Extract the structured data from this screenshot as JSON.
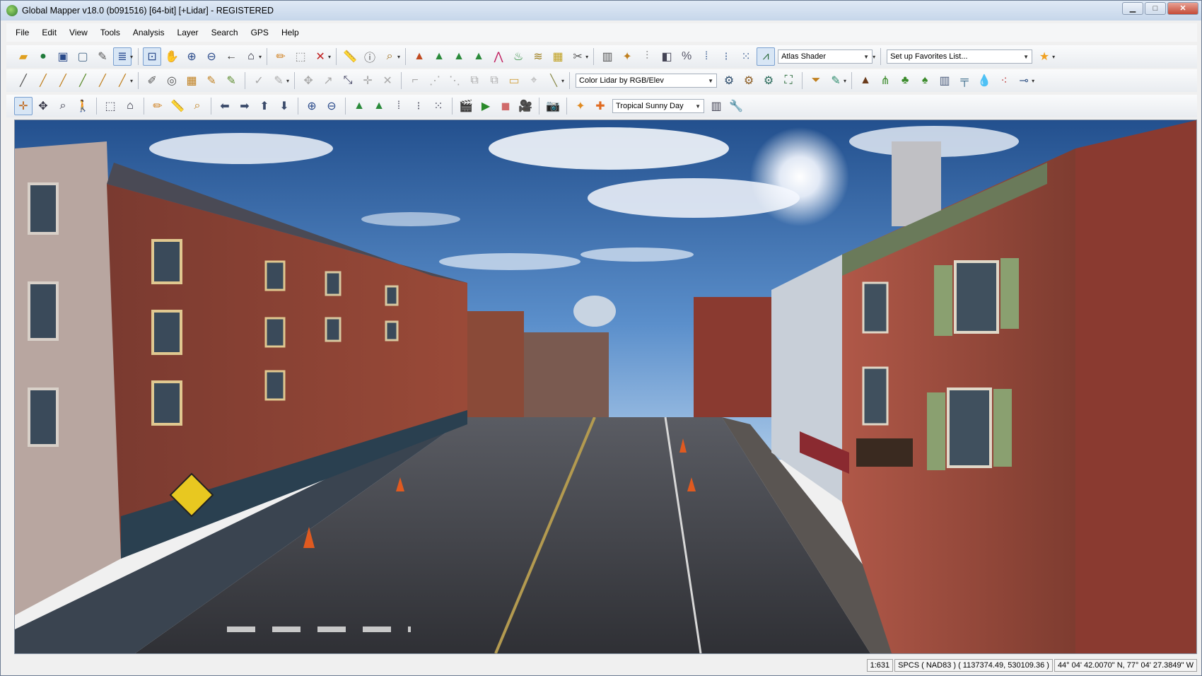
{
  "window": {
    "title": "Global Mapper v18.0 (b091516) [64-bit] [+Lidar] - REGISTERED",
    "minimize": "▁",
    "maximize": "□",
    "close": "✕"
  },
  "menu": [
    "File",
    "Edit",
    "View",
    "Tools",
    "Analysis",
    "Layer",
    "Search",
    "GPS",
    "Help"
  ],
  "toolbar1": {
    "shader_combo": "Atlas Shader",
    "favorites_combo": "Set up Favorites List..."
  },
  "toolbar2": {
    "lidar_color_combo": "Color Lidar by RGB/Elev"
  },
  "toolbar3": {
    "sky_combo": "Tropical Sunny Day"
  },
  "status": {
    "scale": "1:631",
    "projection": "SPCS ( NAD83 ) ( 1137374.49, 530109.36 )",
    "geo_coords": "44° 04' 42.0070\" N, 77° 04' 27.3849\" W"
  },
  "colors": {
    "sky_top": "#2b5a9c",
    "sky_bottom": "#9cc2e6",
    "brick": "#8a3a30",
    "road": "#3e3f44"
  },
  "icons": {
    "toolbar1": [
      "open-folder-icon",
      "globe-icon",
      "save-icon",
      "screen-icon",
      "wrench-icon",
      "layers-icon",
      "zoom-box-icon",
      "pan-hand-icon",
      "zoom-in-icon",
      "zoom-out-icon",
      "back-arrow-icon",
      "home-icon",
      "pencil-icon",
      "select-icon",
      "delete-icon",
      "measure-icon",
      "info-icon",
      "find-icon",
      "terrain-icon",
      "contour-icon",
      "hill-icon",
      "mountain-icon",
      "profile-icon",
      "elevation-icon",
      "grid-icon",
      "image-icon",
      "cut-icon",
      "layout-icon",
      "magic-icon",
      "split-icon",
      "3d-icon",
      "percent-icon",
      "lidar-icon",
      "lidar-filter-icon",
      "classify-icon",
      "shader-icon",
      "star-icon"
    ],
    "toolbar2": [
      "line-tool-icon",
      "line-2-icon",
      "line-3-icon",
      "line-4-icon",
      "line-5-icon",
      "line-6-icon",
      "digitize-icon",
      "circle-icon",
      "grid-digitize-icon",
      "edit-icon",
      "vertex-icon",
      "check-icon",
      "dim-icon",
      "move-icon",
      "rotate-icon",
      "reshape-icon",
      "scale-icon",
      "split-icon",
      "cut-line-icon",
      "vertex-2-icon",
      "join-icon",
      "copy-icon",
      "crop-icon",
      "ruler-icon",
      "gear-1-icon",
      "gear-2-icon",
      "gear-3-icon",
      "gear-4-icon",
      "filter-icon",
      "edit-feature-icon",
      "peak-icon",
      "grass-icon",
      "tree-1-icon",
      "tree-2-icon",
      "building-icon",
      "powerline-icon",
      "water-icon",
      "noise-icon",
      "pin-icon"
    ],
    "toolbar3": [
      "crosshair-icon",
      "move-icon",
      "magnify-icon",
      "walk-icon",
      "cube-icon",
      "home-icon",
      "pencil-icon",
      "measure-icon",
      "path-icon",
      "left-arrow-icon",
      "right-arrow-icon",
      "up-arrow-icon",
      "down-arrow-icon",
      "zoom-in-icon",
      "zoom-out-icon",
      "raise-icon",
      "lower-icon",
      "exaggerate-up-icon",
      "exaggerate-down-icon",
      "lidar-size-icon",
      "film-icon",
      "play-icon",
      "stop-icon",
      "record-icon",
      "camera-icon",
      "sun-icon",
      "cross-icon",
      "panel-icon",
      "settings-icon"
    ]
  }
}
